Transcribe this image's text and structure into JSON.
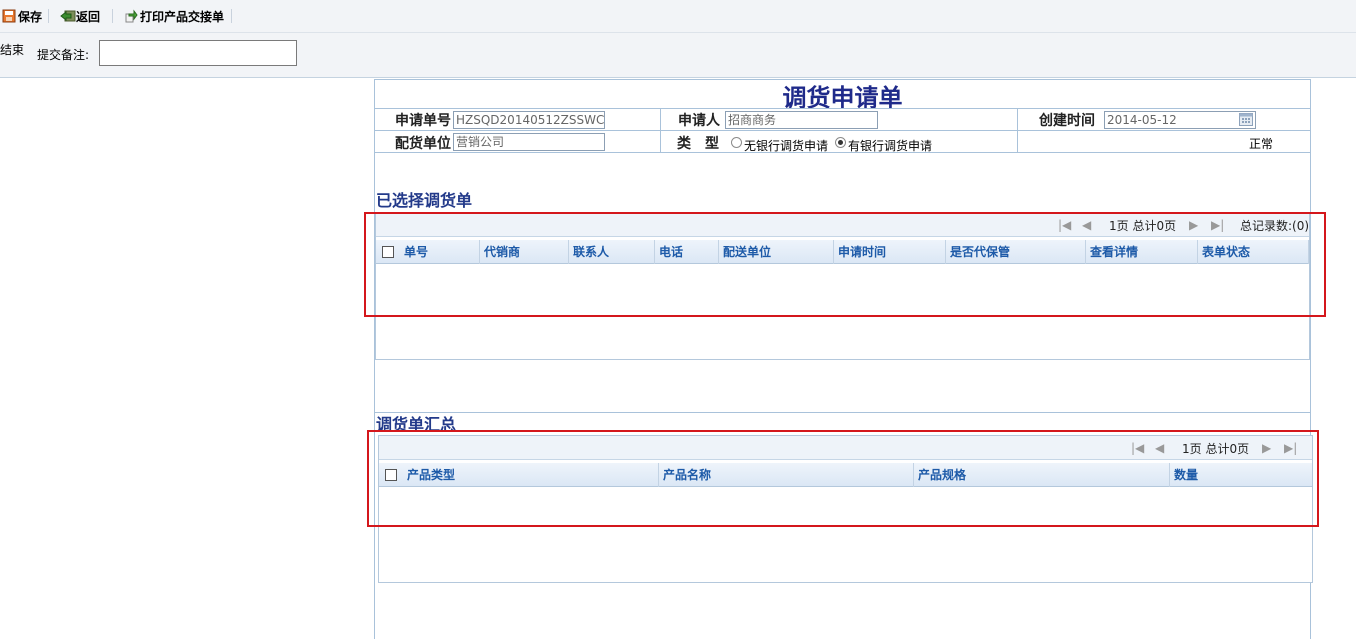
{
  "toolbar": {
    "save_label": "保存",
    "back_label": "返回",
    "print_label": "打印产品交接单"
  },
  "remark": {
    "end_label": "结束",
    "remark_label": "提交备注:",
    "remark_value": ""
  },
  "form": {
    "title": "调货申请单",
    "order_no_label": "申请单号",
    "order_no_value": "HZSQD20140512ZSSWC",
    "applicant_label": "申请人",
    "applicant_value": "招商商务",
    "created_label": "创建时间",
    "created_value": "2014-05-12",
    "unit_label": "配货单位",
    "unit_value": "营销公司",
    "type_label": "类　型",
    "type_options": [
      "无银行调货申请",
      "有银行调货申请"
    ],
    "type_selected": "有银行调货申请",
    "status_value": "正常"
  },
  "selected_orders": {
    "title": "已选择调货单",
    "pager": "1页 总计0页",
    "total": "总记录数:(0)",
    "columns": [
      "单号",
      "代销商",
      "联系人",
      "电话",
      "配送单位",
      "申请时间",
      "是否代保管",
      "查看详情",
      "表单状态"
    ]
  },
  "summary": {
    "title": "调货单汇总",
    "pager": "1页 总计0页",
    "columns": [
      "产品类型",
      "产品名称",
      "产品规格",
      "数量"
    ]
  },
  "colors": {
    "accent": "#1f2a8a",
    "header_text": "#1d5aa8",
    "highlight": "#d4171c"
  }
}
